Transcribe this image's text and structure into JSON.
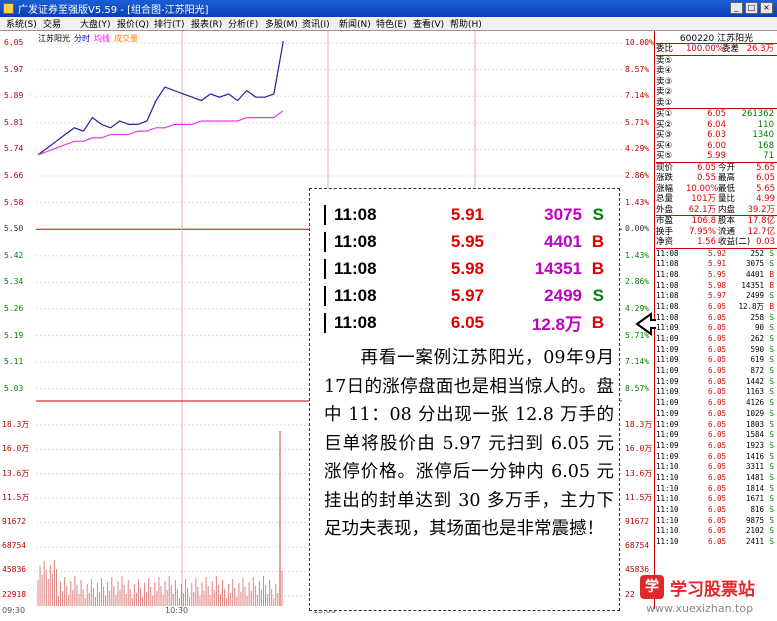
{
  "window": {
    "title": "广发证券至强版V5.59 - [组合图-江苏阳光]"
  },
  "menu": [
    "系统(S)",
    "交易",
    "大盘(Y)",
    "报价(Q)",
    "排行(T)",
    "报表(R)",
    "分析(F)",
    "多股(M)",
    "资讯(I)",
    "新闻(N)",
    "特色(E)",
    "查看(V)",
    "帮助(H)"
  ],
  "chart": {
    "stock_label": "江苏阳光",
    "legend_time": "分时",
    "legend_avg": "均线",
    "legend_vol": "成交量",
    "price_labels": [
      "6.05",
      "5.97",
      "5.89",
      "5.81",
      "5.74",
      "5.66",
      "5.58",
      "5.50",
      "5.42",
      "5.34",
      "5.26",
      "5.19",
      "5.11",
      "5.03"
    ],
    "pct_labels": [
      "10.00%",
      "8.57%",
      "7.14%",
      "5.71%",
      "4.29%",
      "2.86%",
      "1.43%",
      "0.00%",
      "1.43%",
      "2.86%",
      "4.29%",
      "5.71%",
      "7.14%",
      "8.57%"
    ],
    "vol_labels": [
      "18.3万",
      "16.0万",
      "13.6万",
      "11.5万",
      "91672",
      "68754",
      "45836",
      "22918"
    ],
    "vol_right_labels": [
      "18.3万",
      "16.0万",
      "13.6万",
      "11.5万",
      "91672",
      "68754",
      "45836",
      "22"
    ],
    "x_labels": [
      "09:30",
      "10:30",
      "13:00"
    ]
  },
  "chart_data": {
    "type": "line",
    "title": "江苏阳光",
    "series": [
      {
        "name": "分时",
        "values": [
          5.72,
          5.74,
          5.76,
          5.78,
          5.8,
          5.79,
          5.83,
          5.81,
          5.8,
          5.82,
          5.81,
          5.81,
          5.82,
          5.88,
          5.92,
          5.91,
          5.9,
          5.89,
          5.88,
          5.9,
          5.89,
          5.9,
          5.88,
          5.91,
          5.89,
          5.89,
          5.9,
          6.05
        ]
      },
      {
        "name": "均线",
        "values": [
          5.72,
          5.73,
          5.74,
          5.75,
          5.76,
          5.76,
          5.77,
          5.77,
          5.78,
          5.78,
          5.78,
          5.79,
          5.79,
          5.8,
          5.8,
          5.81,
          5.81,
          5.81,
          5.82,
          5.82,
          5.82,
          5.82,
          5.82,
          5.83,
          5.83,
          5.83,
          5.83,
          5.85
        ]
      }
    ],
    "ylim": [
      5.03,
      6.05
    ],
    "xlabel": "",
    "ylabel": ""
  },
  "ticks": [
    {
      "time": "11:08",
      "price": "5.91",
      "vol": "3075",
      "dir": "S"
    },
    {
      "time": "11:08",
      "price": "5.95",
      "vol": "4401",
      "dir": "B"
    },
    {
      "time": "11:08",
      "price": "5.98",
      "vol": "14351",
      "dir": "B"
    },
    {
      "time": "11:08",
      "price": "5.97",
      "vol": "2499",
      "dir": "S"
    },
    {
      "time": "11:08",
      "price": "6.05",
      "vol": "12.8万",
      "dir": "B"
    }
  ],
  "annotation_text": "　　再看一案例江苏阳光，09年9月17日的涨停盘面也是相当惊人的。盘中 11：08 分出现一张 12.8 万手的巨单将股价由 5.97 元扫到 6.05 元涨停价格。涨停后一分钟内 6.05 元挂出的封单达到 30 多万手，主力下足功夫表现，其场面也是非常震撼！",
  "side": {
    "code": "600220 江苏阳光",
    "weibi": {
      "l1": "委比",
      "v1": "100.00%",
      "l2": "委差",
      "v2": "26.3万"
    },
    "sells": [
      {
        "label": "卖⑤",
        "price": "",
        "vol": ""
      },
      {
        "label": "卖④",
        "price": "",
        "vol": ""
      },
      {
        "label": "卖③",
        "price": "",
        "vol": ""
      },
      {
        "label": "卖②",
        "price": "",
        "vol": ""
      },
      {
        "label": "卖①",
        "price": "",
        "vol": ""
      }
    ],
    "buys": [
      {
        "label": "买①",
        "price": "6.05",
        "vol": "261362"
      },
      {
        "label": "买②",
        "price": "6.04",
        "vol": "110"
      },
      {
        "label": "买③",
        "price": "6.03",
        "vol": "1340"
      },
      {
        "label": "买④",
        "price": "6.00",
        "vol": "168"
      },
      {
        "label": "买⑤",
        "price": "5.99",
        "vol": "71"
      }
    ],
    "stats": [
      {
        "l1": "现价",
        "v1": "6.05",
        "l2": "今开",
        "v2": "5.65"
      },
      {
        "l1": "涨跌",
        "v1": "0.55",
        "l2": "最高",
        "v2": "6.05"
      },
      {
        "l1": "涨幅",
        "v1": "10.00%",
        "l2": "最低",
        "v2": "5.65"
      },
      {
        "l1": "总量",
        "v1": "101万",
        "l2": "量比",
        "v2": "4.99"
      },
      {
        "l1": "外盘",
        "v1": "62.1万",
        "l2": "内盘",
        "v2": "39.2万"
      }
    ],
    "stats2": [
      {
        "l1": "市盈",
        "v1": "106.8",
        "l2": "股本",
        "v2": "17.8亿"
      },
      {
        "l1": "换手",
        "v1": "7.95%",
        "l2": "流通",
        "v2": "12.7亿"
      },
      {
        "l1": "净资",
        "v1": "1.56",
        "l2": "收益(二)",
        "v2": "0.03"
      }
    ],
    "trades": [
      {
        "t": "11:08",
        "p": "5.92",
        "v": "252",
        "d": "S"
      },
      {
        "t": "11:08",
        "p": "5.91",
        "v": "3075",
        "d": "S"
      },
      {
        "t": "11:08",
        "p": "5.95",
        "v": "4401",
        "d": "B"
      },
      {
        "t": "11:08",
        "p": "5.98",
        "v": "14351",
        "d": "B"
      },
      {
        "t": "11:08",
        "p": "5.97",
        "v": "2499",
        "d": "S"
      },
      {
        "t": "11:08",
        "p": "6.05",
        "v": "12.8万",
        "d": "B"
      },
      {
        "t": "11:08",
        "p": "6.05",
        "v": "258",
        "d": "S"
      },
      {
        "t": "11:09",
        "p": "6.05",
        "v": "90",
        "d": "S"
      },
      {
        "t": "11:09",
        "p": "6.05",
        "v": "262",
        "d": "S"
      },
      {
        "t": "11:09",
        "p": "6.05",
        "v": "590",
        "d": "S"
      },
      {
        "t": "11:09",
        "p": "6.05",
        "v": "619",
        "d": "S"
      },
      {
        "t": "11:09",
        "p": "6.05",
        "v": "872",
        "d": "S"
      },
      {
        "t": "11:09",
        "p": "6.05",
        "v": "1442",
        "d": "S"
      },
      {
        "t": "11:09",
        "p": "6.05",
        "v": "1163",
        "d": "S"
      },
      {
        "t": "11:09",
        "p": "6.05",
        "v": "4126",
        "d": "S"
      },
      {
        "t": "11:09",
        "p": "6.05",
        "v": "1029",
        "d": "S"
      },
      {
        "t": "11:09",
        "p": "6.05",
        "v": "1803",
        "d": "S"
      },
      {
        "t": "11:09",
        "p": "6.05",
        "v": "1584",
        "d": "S"
      },
      {
        "t": "11:09",
        "p": "6.05",
        "v": "1923",
        "d": "S"
      },
      {
        "t": "11:09",
        "p": "6.05",
        "v": "1416",
        "d": "S"
      },
      {
        "t": "11:10",
        "p": "6.05",
        "v": "3311",
        "d": "S"
      },
      {
        "t": "11:10",
        "p": "6.05",
        "v": "1481",
        "d": "S"
      },
      {
        "t": "11:10",
        "p": "6.05",
        "v": "1814",
        "d": "S"
      },
      {
        "t": "11:10",
        "p": "6.05",
        "v": "1671",
        "d": "S"
      },
      {
        "t": "11:10",
        "p": "6.05",
        "v": "816",
        "d": "S"
      },
      {
        "t": "11:10",
        "p": "6.05",
        "v": "9875",
        "d": "S"
      },
      {
        "t": "11:10",
        "p": "6.05",
        "v": "2102",
        "d": "S"
      },
      {
        "t": "11:10",
        "p": "6.05",
        "v": "2411",
        "d": "S"
      }
    ]
  },
  "brand": {
    "icon": "学",
    "name": "学习股票站",
    "url": "www.xuexizhan.top"
  }
}
